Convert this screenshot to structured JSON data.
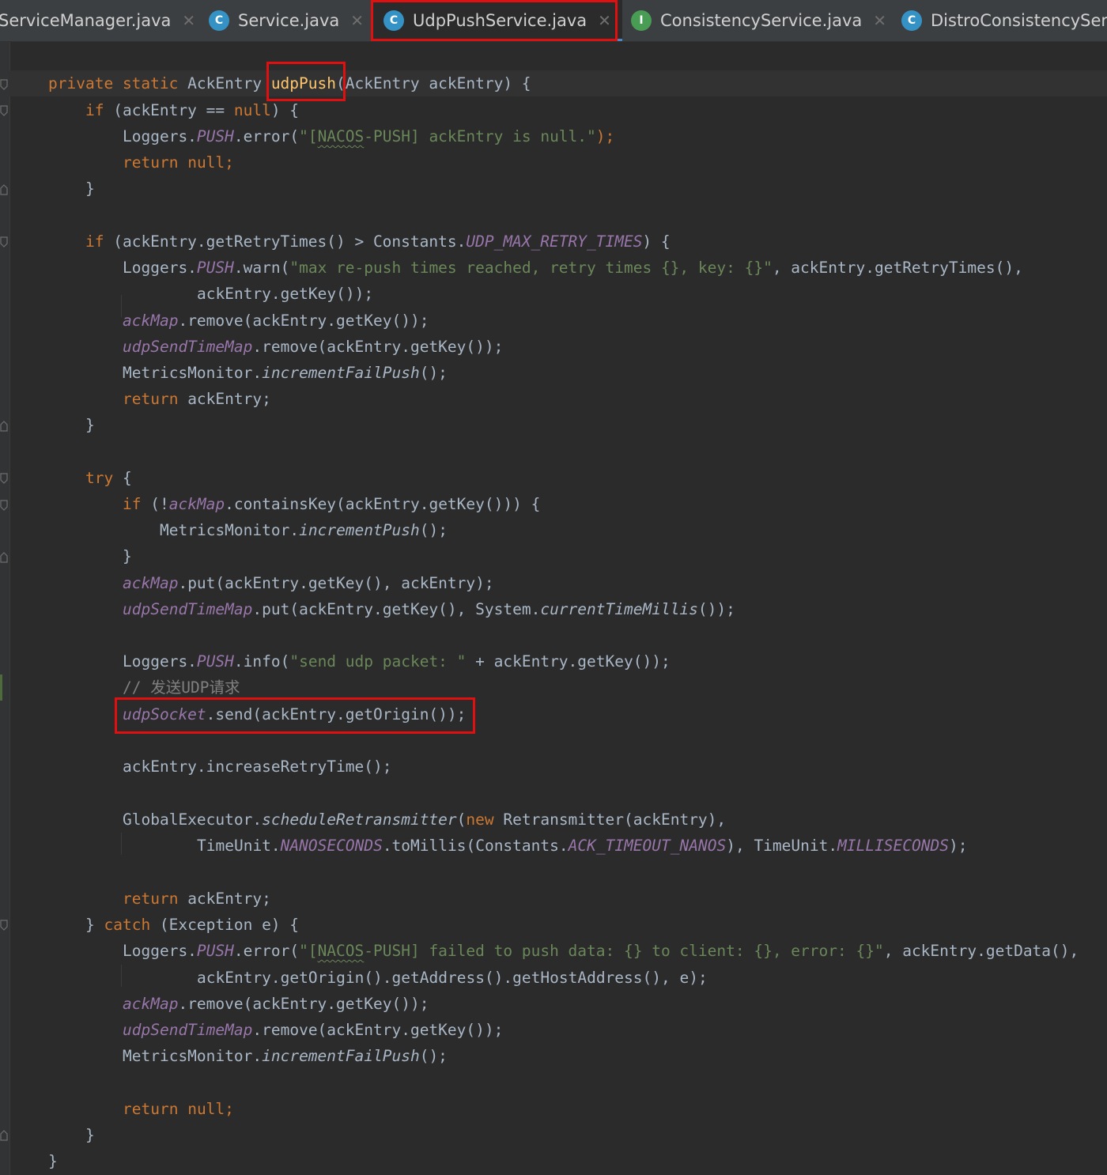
{
  "tabs": [
    {
      "label": "ServiceManager.java",
      "icon": "",
      "active": false,
      "icon_color": ""
    },
    {
      "label": "Service.java",
      "icon": "C",
      "active": false,
      "icon_color": "#3592c4"
    },
    {
      "label": "UdpPushService.java",
      "icon": "C",
      "active": true,
      "icon_color": "#3592c4"
    },
    {
      "label": "ConsistencyService.java",
      "icon": "I",
      "active": false,
      "icon_color": "#499c54"
    },
    {
      "label": "DistroConsistencyServ",
      "icon": "C",
      "active": false,
      "icon_color": "#3592c4"
    }
  ],
  "colors": {
    "keyword": "#cc7832",
    "method_decl": "#ffc66d",
    "string": "#6a8759",
    "field": "#9876aa",
    "comment": "#808080",
    "text": "#a9b7c6",
    "highlight_box": "#e01010",
    "editor_bg": "#2b2b2b"
  },
  "code": {
    "l1": {
      "kw1": "private",
      "kw2": "static",
      "type": "AckEntry",
      "name": "udpPush",
      "params": "(AckEntry ackEntry) {"
    },
    "l2": {
      "kw": "if",
      "a": " (ackEntry == ",
      "b": "null",
      "c": ") {"
    },
    "l3": {
      "a": "Loggers.",
      "b": "PUSH",
      "c": ".error(",
      "d": "\"[",
      "e": "NACOS",
      "f": "-PUSH] ackEntry is null.\"",
      "g": ");"
    },
    "l4": {
      "kw": "return",
      "b": "null;"
    },
    "l5": "}",
    "l7": {
      "kw": "if",
      "a": " (ackEntry.getRetryTimes() > Constants.",
      "b": "UDP_MAX_RETRY_TIMES",
      "c": ") {"
    },
    "l8": {
      "a": "Loggers.",
      "b": "PUSH",
      "c": ".warn(",
      "d": "\"max re-push times reached, retry times {}, key: {}\"",
      "e": ", ackEntry.getRetryTimes(),"
    },
    "l9": {
      "a": "ackEntry.getKey());"
    },
    "l10": {
      "a": "ackMap",
      "b": ".remove(ackEntry.getKey());"
    },
    "l11": {
      "a": "udpSendTimeMap",
      "b": ".remove(ackEntry.getKey());"
    },
    "l12": {
      "a": "MetricsMonitor.",
      "b": "incrementFailPush",
      "c": "();"
    },
    "l13": {
      "kw": "return",
      "b": " ackEntry;"
    },
    "l14": "}",
    "l16": {
      "kw": "try",
      "b": " {"
    },
    "l17": {
      "kw": "if",
      "a": " (!",
      "b": "ackMap",
      "c": ".containsKey(ackEntry.getKey())) {"
    },
    "l18": {
      "a": "MetricsMonitor.",
      "b": "incrementPush",
      "c": "();"
    },
    "l19": "}",
    "l20": {
      "a": "ackMap",
      "b": ".put(ackEntry.getKey(), ackEntry);"
    },
    "l21": {
      "a": "udpSendTimeMap",
      "b": ".put(ackEntry.getKey(), System.",
      "c": "currentTimeMillis",
      "d": "());"
    },
    "l23": {
      "a": "Loggers.",
      "b": "PUSH",
      "c": ".info(",
      "d": "\"send udp packet: \"",
      "e": " + ackEntry.getKey());"
    },
    "l24": "// 发送UDP请求",
    "l25": {
      "a": "udpSocket",
      "b": ".send(ackEntry.getOrigin());"
    },
    "l27": "ackEntry.increaseRetryTime();",
    "l29": {
      "a": "GlobalExecutor.",
      "b": "scheduleRetransmitter",
      "c": "(",
      "kw": "new",
      "d": " Retransmitter(ackEntry),"
    },
    "l30": {
      "a": "TimeUnit.",
      "b": "NANOSECONDS",
      "c": ".toMillis(Constants.",
      "d": "ACK_TIMEOUT_NANOS",
      "e": "), TimeUnit.",
      "f": "MILLISECONDS",
      "g": ");"
    },
    "l32": {
      "kw": "return",
      "b": " ackEntry;"
    },
    "l33": {
      "a": "} ",
      "kw": "catch",
      "b": " (Exception e) {"
    },
    "l34": {
      "a": "Loggers.",
      "b": "PUSH",
      "c": ".error(",
      "d": "\"[",
      "e": "NACOS",
      "f": "-PUSH] failed to push data: {} to client: {}, error: {}\"",
      "g": ", ackEntry.getData(),"
    },
    "l35": {
      "a": "ackEntry.getOrigin().getAddress().getHostAddress(), e);"
    },
    "l36": {
      "a": "ackMap",
      "b": ".remove(ackEntry.getKey());"
    },
    "l37": {
      "a": "udpSendTimeMap",
      "b": ".remove(ackEntry.getKey());"
    },
    "l38": {
      "a": "MetricsMonitor.",
      "b": "incrementFailPush",
      "c": "();"
    },
    "l40": {
      "kw": "return",
      "b": "null;"
    },
    "l41": "}",
    "l42": "}"
  }
}
